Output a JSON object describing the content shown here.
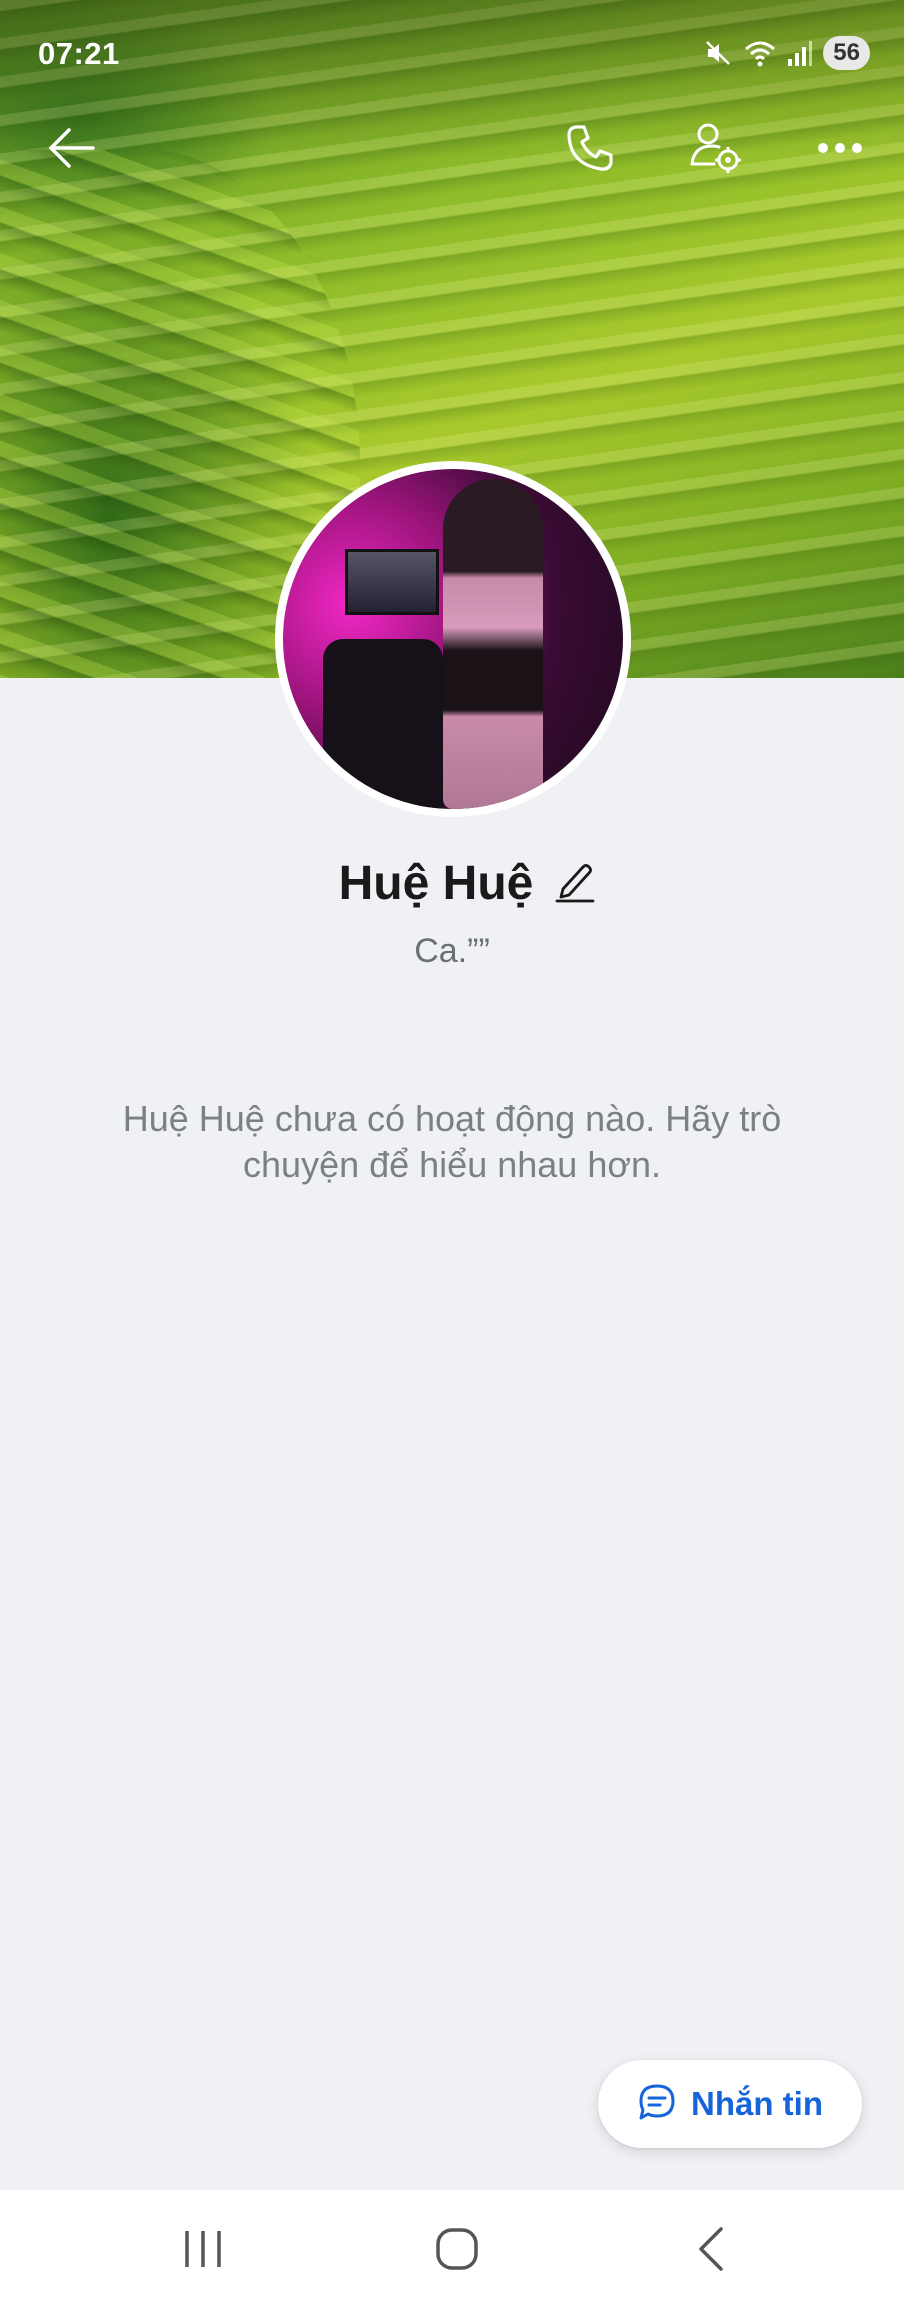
{
  "status_bar": {
    "time": "07:21",
    "battery_level": "56",
    "icons": [
      "mute-icon",
      "wifi-icon",
      "signal-icon",
      "battery-icon"
    ]
  },
  "app_bar": {
    "icons": [
      "back-arrow-icon",
      "phone-icon",
      "user-settings-icon",
      "more-horizontal-icon"
    ]
  },
  "profile": {
    "name": "Huệ Huệ",
    "status": "Ca.””",
    "empty_message": "Huệ Huệ chưa có hoạt động nào. Hãy trò chuyện để hiểu nhau hơn."
  },
  "fab": {
    "label": "Nhắn tin",
    "icon": "chat-bubble-icon"
  },
  "nav_bar": {
    "icons": [
      "recent-apps-icon",
      "home-icon",
      "back-icon"
    ]
  },
  "colors": {
    "background": "#f0f1f5",
    "accent": "#1664d9",
    "name_text": "#1a1a1a",
    "muted_text": "#7c7f85"
  }
}
